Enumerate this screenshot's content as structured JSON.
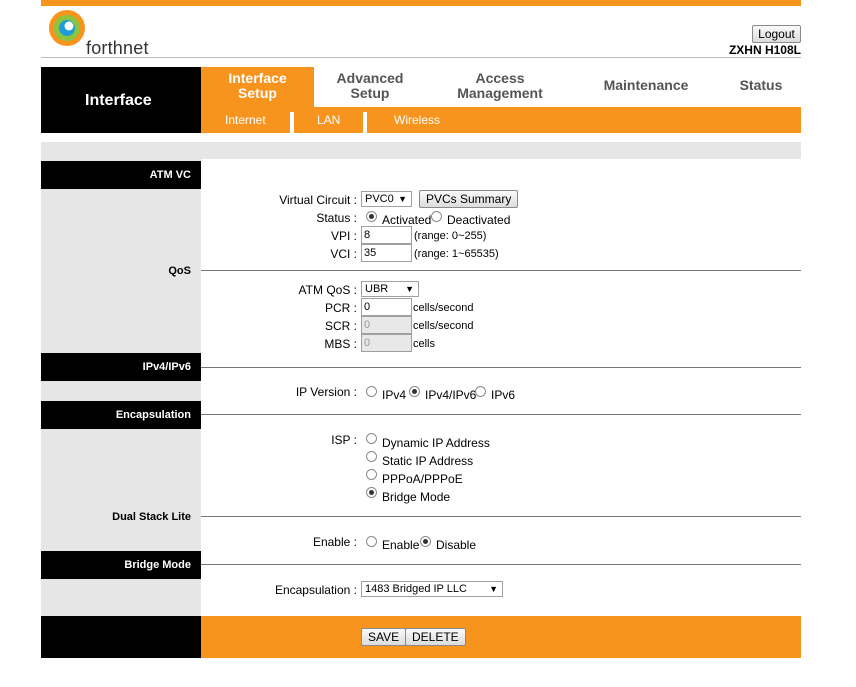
{
  "header": {
    "brand": "forthnet",
    "logout_label": "Logout",
    "model": "ZXHN H108L",
    "accent_color": "#f7941d"
  },
  "nav": {
    "section_title": "Interface",
    "tabs": [
      {
        "line1": "Interface",
        "line2": "Setup",
        "active": true
      },
      {
        "line1": "Advanced",
        "line2": "Setup",
        "active": false
      },
      {
        "line1": "Access",
        "line2": "Management",
        "active": false
      },
      {
        "line1": "Maintenance",
        "line2": "",
        "active": false
      },
      {
        "line1": "Status",
        "line2": "",
        "active": false
      }
    ],
    "subtabs": [
      "Internet",
      "LAN",
      "Wireless"
    ]
  },
  "sections": {
    "atm_vc": "ATM VC",
    "qos": "QoS",
    "ipv4ipv6": "IPv4/IPv6",
    "encapsulation": "Encapsulation",
    "dual_stack_lite": "Dual Stack Lite",
    "bridge_mode": "Bridge Mode"
  },
  "atm": {
    "virtual_circuit_label": "Virtual Circuit :",
    "virtual_circuit_value": "PVC0",
    "pvcs_summary_label": "PVCs Summary",
    "status_label": "Status :",
    "status_options": [
      "Activated",
      "Deactivated"
    ],
    "status_selected": "Activated",
    "vpi_label": "VPI :",
    "vpi_value": "8",
    "vpi_range": "(range: 0~255)",
    "vci_label": "VCI :",
    "vci_value": "35",
    "vci_range": "(range: 1~65535)"
  },
  "qos": {
    "atm_qos_label": "ATM QoS :",
    "atm_qos_value": "UBR",
    "pcr_label": "PCR :",
    "pcr_value": "0",
    "pcr_unit": "cells/second",
    "scr_label": "SCR :",
    "scr_value": "0",
    "scr_unit": "cells/second",
    "mbs_label": "MBS :",
    "mbs_value": "0",
    "mbs_unit": "cells"
  },
  "ip": {
    "ip_version_label": "IP Version :",
    "options": [
      "IPv4",
      "IPv4/IPv6",
      "IPv6"
    ],
    "selected": "IPv4/IPv6"
  },
  "encap": {
    "isp_label": "ISP :",
    "options": [
      "Dynamic IP Address",
      "Static IP Address",
      "PPPoA/PPPoE",
      "Bridge Mode"
    ],
    "selected": "Bridge Mode"
  },
  "dslite": {
    "enable_label": "Enable :",
    "options": [
      "Enable",
      "Disable"
    ],
    "selected": "Disable"
  },
  "bridge": {
    "encapsulation_label": "Encapsulation :",
    "encapsulation_value": "1483 Bridged IP LLC"
  },
  "footer": {
    "save_label": "SAVE",
    "delete_label": "DELETE"
  }
}
